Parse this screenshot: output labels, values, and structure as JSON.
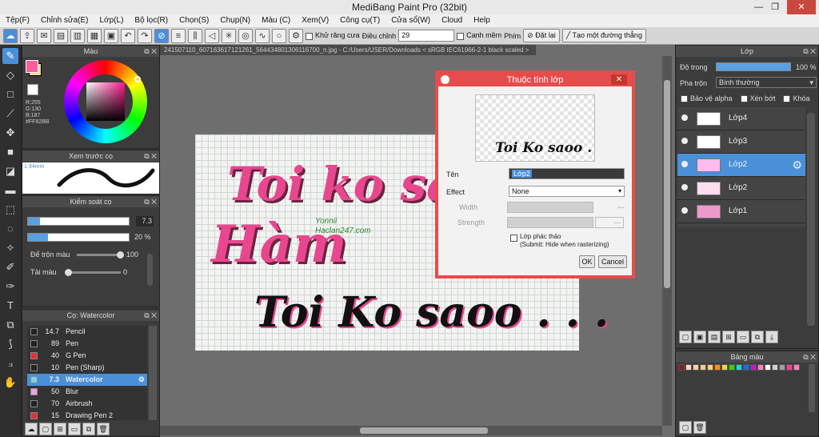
{
  "window": {
    "title": "MediBang Paint Pro (32bit)",
    "min": "—",
    "max": "❐",
    "close": "✕"
  },
  "menu": [
    "Tệp(F)",
    "Chỉnh sửa(E)",
    "Lớp(L)",
    "Bộ lọc(R)",
    "Chọn(S)",
    "Chụp(N)",
    "Màu (C)",
    "Xem(V)",
    "Công cụ(T)",
    "Cửa sổ(W)",
    "Cloud",
    "Help"
  ],
  "toolbar": {
    "antialias": "Khử răng cưa",
    "adjust_label": "Điều chỉnh",
    "adjust_value": "29",
    "smooth": "Canh mềm",
    "key_label": "Phím",
    "reset": "Đặt lại",
    "create_line": "Tạo một đường thẳng"
  },
  "color_panel": {
    "title": "Màu",
    "r": "R:255",
    "g": "G:130",
    "b": "B:187",
    "hex": "#FF82BB",
    "fg": "#ff5c9c",
    "bg": "#f5d49a"
  },
  "brush_preview": {
    "title": "Xem trước cọ",
    "size": "1.94mm"
  },
  "brush_control": {
    "title": "Kiểm soát cọ",
    "size_value": "7.3",
    "opacity_value": "20",
    "opacity_unit": "%",
    "mix_label": "Để trộn màu",
    "mix_value": "100",
    "color_label": "Tải màu",
    "color_value": "0"
  },
  "brush_list": {
    "title": "Cọ: Watercolor",
    "items": [
      {
        "size": "14.7",
        "name": "Pencil",
        "color": "#222222"
      },
      {
        "size": "89",
        "name": "Pen",
        "color": "#222222"
      },
      {
        "size": "40",
        "name": "G Pen",
        "color": "#e53030"
      },
      {
        "size": "10",
        "name": "Pen (Sharp)",
        "color": "#222222"
      },
      {
        "size": "7.3",
        "name": "Watercolor",
        "color": "#7fd0f0"
      },
      {
        "size": "50",
        "name": "Blur",
        "color": "#f0a0e0"
      },
      {
        "size": "70",
        "name": "Airbrush",
        "color": "#222222"
      },
      {
        "size": "15",
        "name": "Drawing Pen 2",
        "color": "#e53030"
      }
    ]
  },
  "document": {
    "tab": "241507110_607163617121261_564434801306116700_n.jpg - C:/Users/USER/Downloads < sRGB IEC61966-2-1 black scaled >"
  },
  "artwork": {
    "line1": "Toi ko sa",
    "line2": "Hàm",
    "line3": "Toi Ko saoo . . .",
    "watermark1": "Yonnii",
    "watermark2": "Haclan247.com"
  },
  "dialog": {
    "title": "Thuộc tính lớp",
    "preview_text": "Toi Ko saoo . . .",
    "name_label": "Tên",
    "name_value": "Lớp2",
    "effect_label": "Effect",
    "effect_value": "None",
    "width_label": "Width",
    "width_value": "---",
    "strength_label": "Strength",
    "strength_value": "---",
    "draft_label": "Lớp phác thảo",
    "draft_sub": "(Submit: Hide when rasterizing)",
    "ok": "OK",
    "cancel": "Cancel"
  },
  "layer_panel": {
    "title": "Lớp",
    "opacity_label": "Độ trong",
    "opacity_value": "100 %",
    "opacity_fraction": 1.0,
    "blend_label": "Pha trộn",
    "blend_value": "Bình thường",
    "protect_alpha": "Bảo vệ alpha",
    "clip": "Xén bớt",
    "lock": "Khóa",
    "layers": [
      {
        "name": "Lớp4"
      },
      {
        "name": "Lớp3"
      },
      {
        "name": "Lớp2"
      },
      {
        "name": "Lớp2"
      },
      {
        "name": "Lớp1"
      }
    ]
  },
  "palette_panel": {
    "title": "Bảng màu",
    "colors": [
      "#8b1a1a",
      "#ffd7c4",
      "#ffcfa8",
      "#f5c89a",
      "#ffcf7a",
      "#ff8c1a",
      "#ffd23a",
      "#2ad02a",
      "#1ad8d8",
      "#1a6cf0",
      "#c01ac0",
      "#ff7fbf",
      "#ffffff",
      "#d0d0d0",
      "#a0a0a0",
      "#ff3d8c",
      "#ff82bb"
    ]
  }
}
